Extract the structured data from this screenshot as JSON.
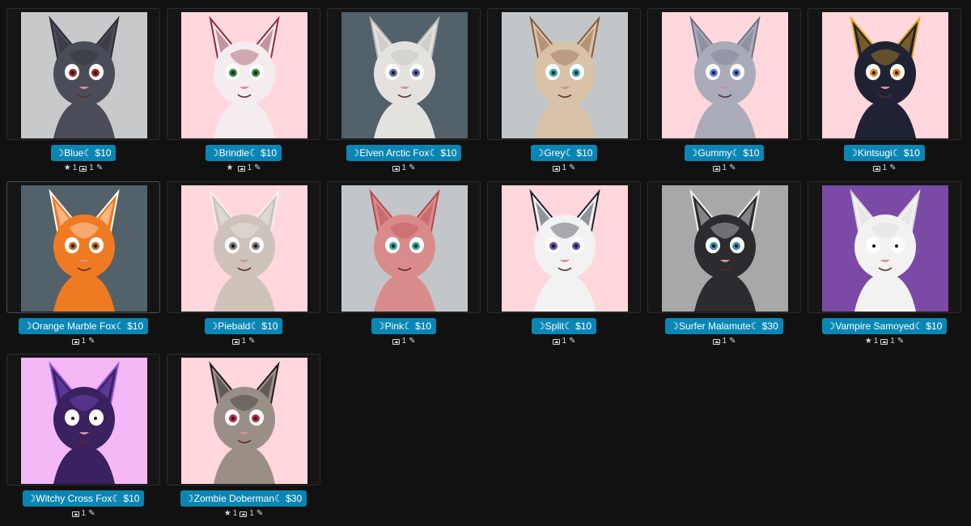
{
  "items": [
    {
      "label": "☽Blue☾ $10",
      "favorites": "1",
      "images": "1",
      "bg": "#c7c9ca",
      "fur": "#4a4d57",
      "accent": "#2a2c33",
      "eye": "#9b2a2a",
      "show_star": true,
      "edit_icon": "pencil-icon"
    },
    {
      "label": "☽Brindle☾ $10",
      "favorites": "",
      "images": "1",
      "bg": "#ffd7dc",
      "fur": "#f4ecee",
      "accent": "#8e2a3b",
      "eye": "#2f8a3a",
      "show_star": true,
      "edit_icon": "pencil-icon"
    },
    {
      "label": "☽Elven Arctic Fox☾ $10",
      "favorites": "",
      "images": "1",
      "bg": "#52616a",
      "fur": "#e4e2df",
      "accent": "#b9b6b2",
      "eye": "#5f6fa4",
      "show_star": false,
      "edit_icon": "pencil-icon"
    },
    {
      "label": "☽Grey☾ $10",
      "favorites": "",
      "images": "1",
      "bg": "#c2c6c8",
      "fur": "#d8c2a8",
      "accent": "#8b5a3c",
      "eye": "#2fa6a6",
      "show_star": false,
      "edit_icon": "pencil-icon"
    },
    {
      "label": "☽Gummy☾ $10",
      "favorites": "",
      "images": "1",
      "bg": "#ffd7dc",
      "fur": "#a9acb8",
      "accent": "#6d7283",
      "eye": "#5d7fd4",
      "show_star": false,
      "edit_icon": "pencil-icon"
    },
    {
      "label": "☽Kintsugi☾ $10",
      "favorites": "",
      "images": "1",
      "bg": "#ffd7dc",
      "fur": "#1e2233",
      "accent": "#e0a518",
      "eye": "#e08a18",
      "show_star": false,
      "edit_icon": "pencil-icon"
    },
    {
      "label": "☽Orange Marble Fox☾ $10",
      "favorites": "",
      "images": "1",
      "bg": "#52616a",
      "fur": "#f07a22",
      "accent": "#ffffff",
      "eye": "#c46a12",
      "show_star": false,
      "edit_icon": "pencil-icon"
    },
    {
      "label": "☽Piebald☾ $10",
      "favorites": "",
      "images": "1",
      "bg": "#ffd7dc",
      "fur": "#cdc3ba",
      "accent": "#f3f1ef",
      "eye": "#7d7d7d",
      "show_star": false,
      "edit_icon": "pencil-icon"
    },
    {
      "label": "☽Pink☾ $10",
      "favorites": "",
      "images": "1",
      "bg": "#c2c6c8",
      "fur": "#d98b8b",
      "accent": "#b8464e",
      "eye": "#2fa6a6",
      "show_star": false,
      "edit_icon": "pencil-icon"
    },
    {
      "label": "☽Split☾ $10",
      "favorites": "",
      "images": "1",
      "bg": "#ffd7dc",
      "fur": "#f2f2f2",
      "accent": "#1f2130",
      "eye": "#6a4fb0",
      "show_star": false,
      "edit_icon": "pencil-icon"
    },
    {
      "label": "☽Surfer Malamute☾ $30",
      "favorites": "",
      "images": "1",
      "bg": "#a8a8a8",
      "fur": "#2b2b30",
      "accent": "#f2f2f2",
      "eye": "#3c8fb0",
      "show_star": false,
      "edit_icon": "pencil-icon"
    },
    {
      "label": "☽Vampire Samoyed☾ $10",
      "favorites": "1",
      "images": "1",
      "bg": "#7b4aa6",
      "fur": "#f2f2f2",
      "accent": "#d9d9d9",
      "eye": "#ffffff",
      "show_star": true,
      "edit_icon": "pencil-icon"
    },
    {
      "label": "☽Witchy Cross Fox☾ $10",
      "favorites": "",
      "images": "1",
      "bg": "#f3b8f5",
      "fur": "#3a2160",
      "accent": "#8a52d6",
      "eye": "#ffffff",
      "show_star": false,
      "edit_icon": "pencil-icon"
    },
    {
      "label": "☽Zombie Doberman☾ $30",
      "favorites": "1",
      "images": "1",
      "bg": "#ffd7dc",
      "fur": "#9a8f86",
      "accent": "#1d1d1f",
      "eye": "#c02a4a",
      "show_star": true,
      "edit_icon": "pencil-icon"
    }
  ],
  "icons": {
    "favorite": "star-icon",
    "image": "image-icon",
    "edit": "pencil-icon"
  },
  "colors": {
    "label_bg": "#0a86b4",
    "page_bg": "#111111"
  }
}
